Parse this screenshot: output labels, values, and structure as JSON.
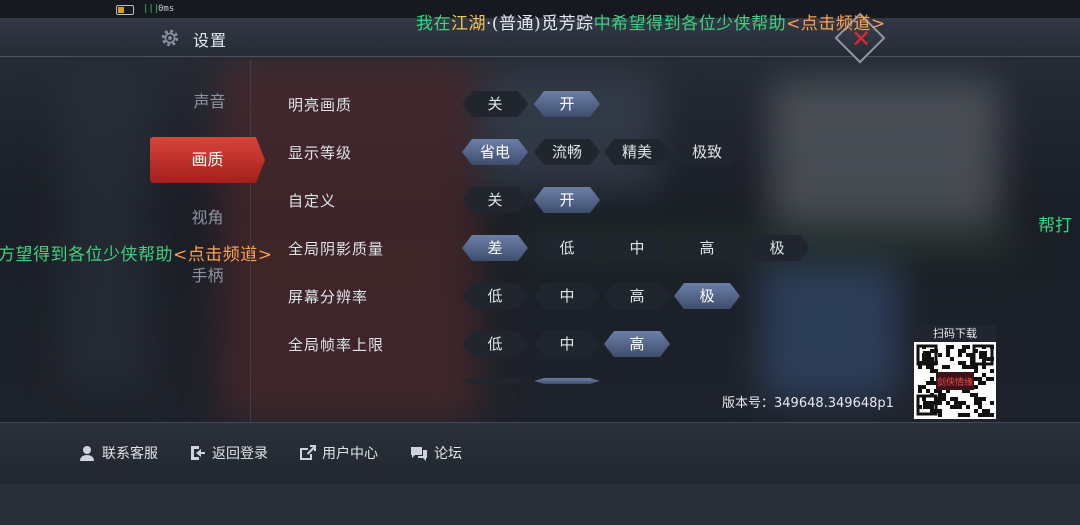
{
  "status_bar": {
    "ping": "0ms",
    "signal": "|||"
  },
  "header": {
    "title": "设置"
  },
  "chat_top": [
    {
      "text": "我在",
      "color": "green"
    },
    {
      "text": "江湖",
      "color": "yellow"
    },
    {
      "text": "·(普通)觅芳踪",
      "color": "white"
    },
    {
      "text": "中希望得到各位少侠帮助",
      "color": "green"
    },
    {
      "text": "<点击频道>",
      "color": "orange"
    }
  ],
  "chat_mid": [
    {
      "text": "方望得到各位少侠帮助",
      "color": "green"
    },
    {
      "text": "<点击频道>",
      "color": "orange"
    }
  ],
  "chat_right": "帮打",
  "sidebar": {
    "items": [
      {
        "label": "声音",
        "active": false
      },
      {
        "label": "画质",
        "active": true
      },
      {
        "label": "视角",
        "active": false
      },
      {
        "label": "手柄",
        "active": false
      }
    ]
  },
  "settings": [
    {
      "label": "明亮画质",
      "options": [
        "关",
        "开"
      ],
      "selected": 1
    },
    {
      "label": "显示等级",
      "options": [
        "省电",
        "流畅",
        "精美",
        "极致"
      ],
      "selected": 0
    },
    {
      "label": "自定义",
      "options": [
        "关",
        "开"
      ],
      "selected": 1
    },
    {
      "label": "全局阴影质量",
      "options": [
        "差",
        "低",
        "中",
        "高",
        "极"
      ],
      "selected": 0
    },
    {
      "label": "屏幕分辨率",
      "options": [
        "低",
        "中",
        "高",
        "极"
      ],
      "selected": 3
    },
    {
      "label": "全局帧率上限",
      "options": [
        "低",
        "中",
        "高"
      ],
      "selected": 2
    }
  ],
  "qr": {
    "title": "扫码下载",
    "logo_text": "剑侠情缘"
  },
  "version": "版本号：349648.349648p1",
  "footer": {
    "items": [
      {
        "label": "联系客服",
        "icon": "customer-service-icon"
      },
      {
        "label": "返回登录",
        "icon": "return-login-icon"
      },
      {
        "label": "用户中心",
        "icon": "user-center-icon"
      },
      {
        "label": "论坛",
        "icon": "forum-icon"
      }
    ]
  },
  "colors": {
    "green": "#3fd27e",
    "yellow": "#f5c84a",
    "orange": "#ffa34f",
    "white": "#e8eaef",
    "active_tab": "#c9302c",
    "selected_option": "#56688f"
  }
}
